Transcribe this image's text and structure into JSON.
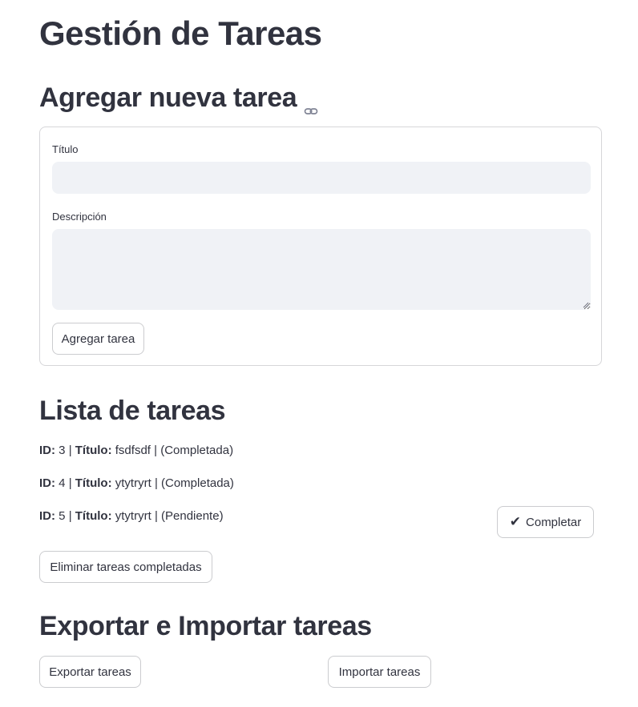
{
  "page": {
    "title": "Gestión de Tareas"
  },
  "add_section": {
    "heading": "Agregar nueva tarea",
    "link_icon": "link-icon",
    "title_label": "Título",
    "title_value": "",
    "description_label": "Descripción",
    "description_value": "",
    "submit_label": "Agregar tarea"
  },
  "list_section": {
    "heading": "Lista de tareas",
    "id_label": "ID:",
    "title_label": "Título:",
    "separator": "|",
    "tasks": [
      {
        "id": "3",
        "title": "fsdfsdf",
        "status": "(Completada)"
      },
      {
        "id": "4",
        "title": "ytytryrt",
        "status": "(Completada)"
      },
      {
        "id": "5",
        "title": "ytytryrt",
        "status": "(Pendiente)"
      }
    ],
    "complete_label": "Completar",
    "complete_icon": "✔",
    "delete_completed_label": "Eliminar tareas completadas"
  },
  "io_section": {
    "heading": "Exportar e Importar tareas",
    "export_label": "Exportar tareas",
    "import_label": "Importar tareas"
  }
}
